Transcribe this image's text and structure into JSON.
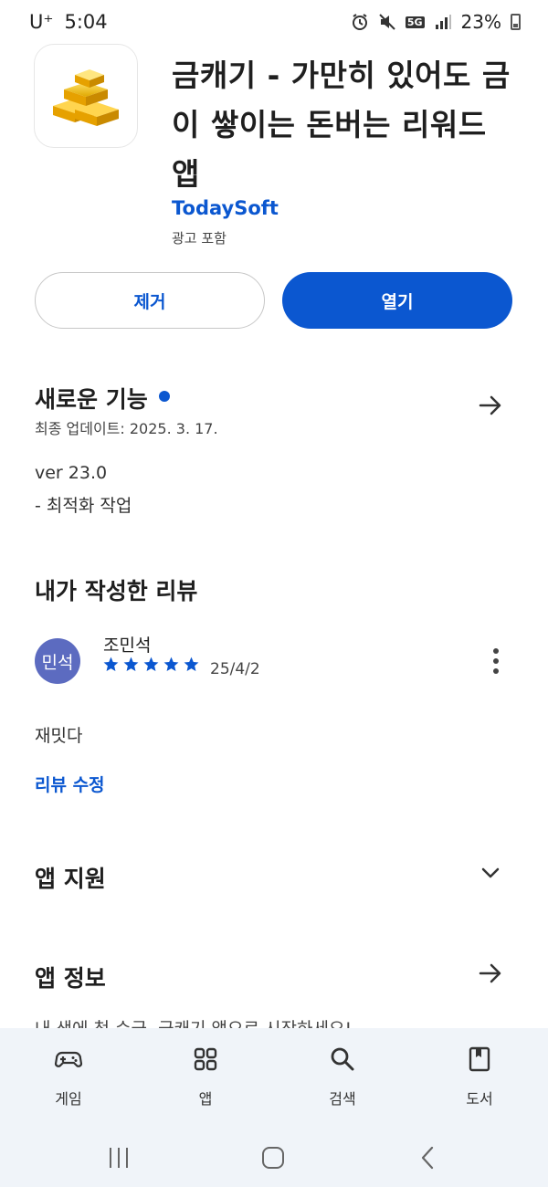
{
  "status_bar": {
    "carrier": "U⁺",
    "time": "5:04",
    "network": "5G",
    "battery": "23%"
  },
  "app": {
    "title": "금캐기 - 가만히 있어도 금이 쌓이는 돈버는 리워드 앱",
    "developer": "TodaySoft",
    "ads_note": "광고 포함",
    "icon": "gold-bars-icon"
  },
  "actions": {
    "uninstall_label": "제거",
    "open_label": "열기"
  },
  "whats_new": {
    "title": "새로운 기능",
    "last_updated": "최종 업데이트: 2025. 3. 17.",
    "version": "ver 23.0",
    "notes": "- 최적화 작업"
  },
  "my_review": {
    "title": "내가 작성한 리뷰",
    "avatar_text": "민석",
    "reviewer": "조민석",
    "rating": 5,
    "date": "25/4/2",
    "text": "재밋다",
    "edit_label": "리뷰 수정"
  },
  "app_support": {
    "title": "앱 지원"
  },
  "app_info": {
    "title": "앱 정보",
    "peek_text": "내 생에 첫 수금, 금캐기 앱으로 시작하세요!"
  },
  "bottom_nav": {
    "items": [
      {
        "label": "게임",
        "icon": "gamepad-icon"
      },
      {
        "label": "앱",
        "icon": "apps-grid-icon"
      },
      {
        "label": "검색",
        "icon": "search-icon"
      },
      {
        "label": "도서",
        "icon": "book-icon"
      }
    ]
  },
  "colors": {
    "accent": "#0b57d0",
    "avatar": "#5c6bc0",
    "nav_bg": "#f0f4f9"
  }
}
